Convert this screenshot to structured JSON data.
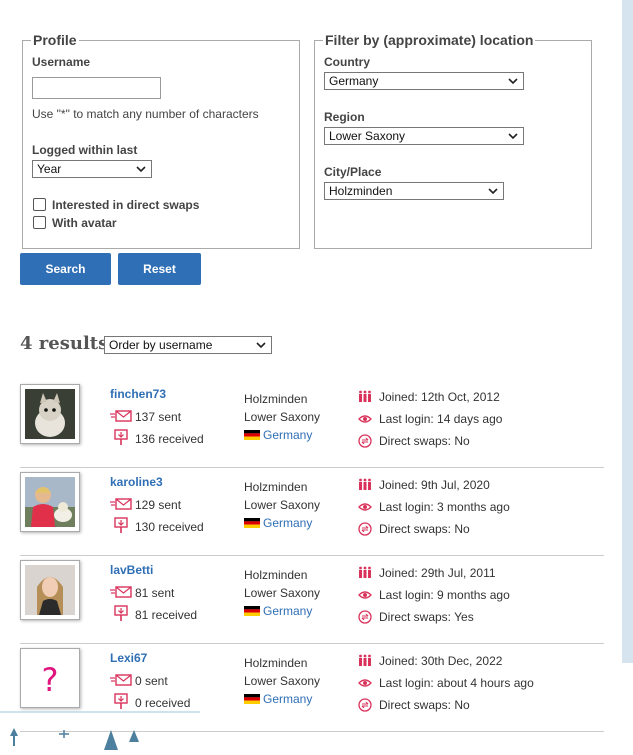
{
  "profile": {
    "legend": "Profile",
    "username_label": "Username",
    "username_value": "",
    "wildcard_note": "Use \"*\" to match any number of characters",
    "logged_label": "Logged within last",
    "logged_value": "Year",
    "direct_swaps_label": "Interested in direct swaps",
    "with_avatar_label": "With avatar"
  },
  "location": {
    "legend": "Filter by (approximate) location",
    "country_label": "Country",
    "country_value": "Germany",
    "region_label": "Region",
    "region_value": "Lower Saxony",
    "city_label": "City/Place",
    "city_value": "Holzminden"
  },
  "buttons": {
    "search": "Search",
    "reset": "Reset"
  },
  "results": {
    "count_text": "4 results",
    "order_value": "Order by username"
  },
  "users": [
    {
      "username": "finchen73",
      "sent": "137 sent",
      "received": "136 received",
      "city": "Holzminden",
      "region": "Lower Saxony",
      "country": "Germany",
      "joined": "Joined: 12th Oct, 2012",
      "last_login": "Last login: 14 days ago",
      "direct_swaps": "Direct swaps: No",
      "avatar": "cat-photo"
    },
    {
      "username": "karoline3",
      "sent": "129 sent",
      "received": "130 received",
      "city": "Holzminden",
      "region": "Lower Saxony",
      "country": "Germany",
      "joined": "Joined: 9th Jul, 2020",
      "last_login": "Last login: 3 months ago",
      "direct_swaps": "Direct swaps: No",
      "avatar": "person-with-dog-photo"
    },
    {
      "username": "lavBetti",
      "sent": "81 sent",
      "received": "81 received",
      "city": "Holzminden",
      "region": "Lower Saxony",
      "country": "Germany",
      "joined": "Joined: 29th Jul, 2011",
      "last_login": "Last login: 9 months ago",
      "direct_swaps": "Direct swaps: Yes",
      "avatar": "woman-portrait-photo"
    },
    {
      "username": "Lexi67",
      "sent": "0 sent",
      "received": "0 received",
      "city": "Holzminden",
      "region": "Lower Saxony",
      "country": "Germany",
      "joined": "Joined: 30th Dec, 2022",
      "last_login": "Last login: about 4 hours ago",
      "direct_swaps": "Direct swaps: No",
      "avatar": "question-mark"
    }
  ],
  "colors": {
    "accent": "#2f6fb5",
    "icon_red": "#d9325b",
    "strip": "#d6e4ef"
  }
}
